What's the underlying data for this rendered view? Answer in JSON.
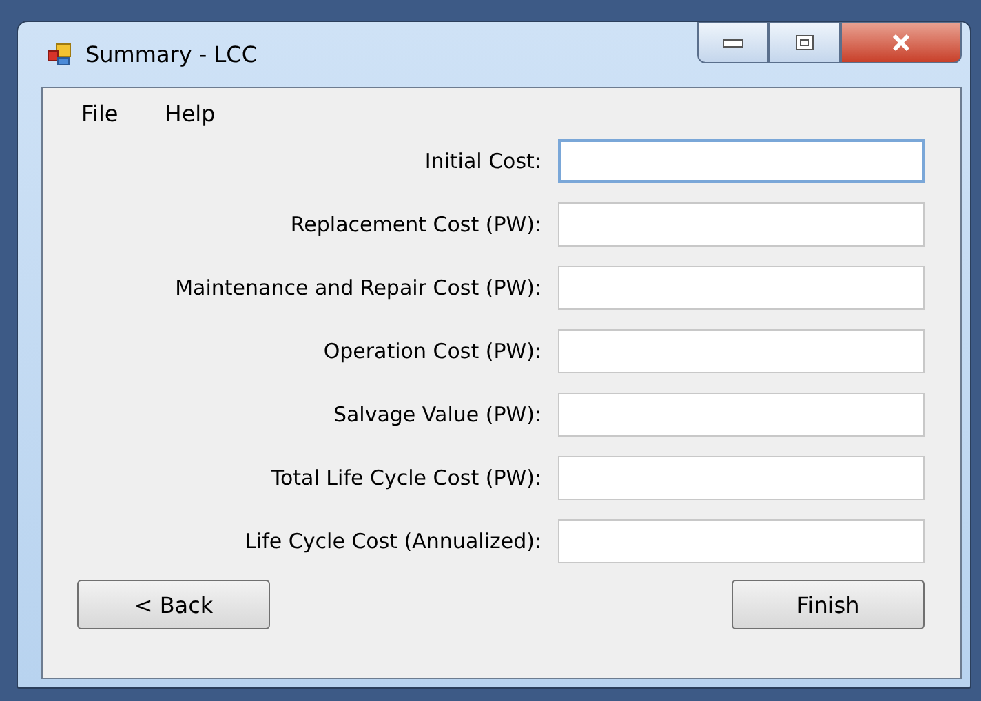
{
  "window": {
    "title": "Summary - LCC"
  },
  "menu": [
    "File",
    "Help"
  ],
  "fields": [
    {
      "label": "Initial Cost:",
      "focused": true
    },
    {
      "label": "Replacement Cost (PW):",
      "focused": false
    },
    {
      "label": "Maintenance and Repair Cost (PW):",
      "focused": false
    },
    {
      "label": "Operation Cost (PW):",
      "focused": false
    },
    {
      "label": "Salvage Value (PW):",
      "focused": false
    },
    {
      "label": "Total Life Cycle Cost (PW):",
      "focused": false
    },
    {
      "label": "Life Cycle Cost (Annualized):",
      "focused": false
    }
  ],
  "buttons": {
    "back": "< Back",
    "finish": "Finish"
  }
}
